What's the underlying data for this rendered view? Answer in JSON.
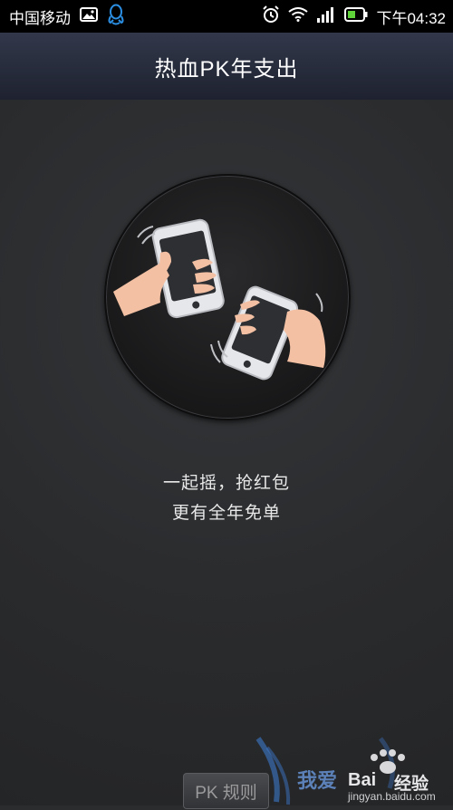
{
  "status_bar": {
    "carrier": "中国移动",
    "time": "下午04:32"
  },
  "header": {
    "title": "热血PK年支出"
  },
  "main": {
    "slogan_line1": "一起摇，抢红包",
    "slogan_line2": "更有全年免单"
  },
  "footer": {
    "pk_rules_button": "PK 规则"
  },
  "watermark": {
    "brand": "Bai",
    "brand_tail": "经验",
    "url": "jingyan.baidu.com",
    "slogan": "我爱"
  },
  "colors": {
    "status_bar_bg": "#000000",
    "title_bar_bg": "#2a2f3f",
    "content_bg": "#2b2c2e",
    "battery_green": "#5fd33a",
    "qq_blue": "#2b8fe3"
  }
}
